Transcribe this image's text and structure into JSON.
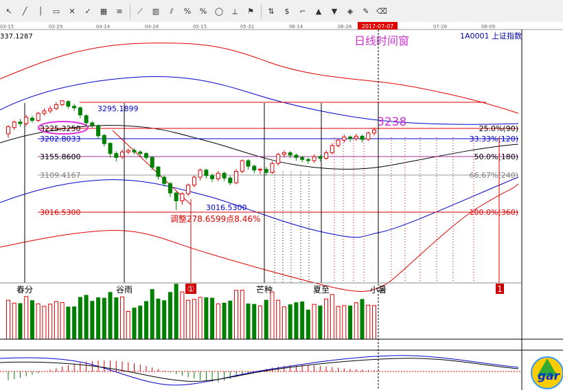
{
  "toolbar": {
    "icons": [
      "cursor-icon",
      "line-icon",
      "vertical-line-icon",
      "rect-icon",
      "cross-icon",
      "check-icon",
      "grid-icon",
      "lines-icon",
      "diag-icon",
      "bar-icon",
      "channel-icon",
      "percent-icon",
      "percent-small-icon",
      "circle-icon",
      "line-fan-icon",
      "flag-icon",
      "arrows-icon",
      "dollar-icon",
      "ruler-icon",
      "arrow-up-icon",
      "arrow-down-icon",
      "mark-icon",
      "pencil-icon",
      "eraser-icon"
    ]
  },
  "header": {
    "left_price": "337.1287",
    "window_title": "日线时间窗",
    "symbol": "1A0001 上证指数",
    "current_price": "3238"
  },
  "colors": {
    "red": "#e00000",
    "blue": "#0000cc",
    "black": "#000000",
    "green": "#008000",
    "magenta": "#cc33cc",
    "gray": "#808080"
  },
  "chart_data": {
    "type": "candlestick",
    "dates": [
      "03-15",
      "03-29",
      "04-14",
      "04-28",
      "05-15",
      "05-31",
      "06-14",
      "06-28",
      "2017-07-07",
      "07-26",
      "08-09"
    ],
    "highlighted_date": "2017-07-07",
    "price_labels": [
      {
        "label": "3295.1899",
        "color": "blue"
      },
      {
        "label": "3225.3250",
        "color": "black"
      },
      {
        "label": "3202.8033",
        "color": "blue"
      },
      {
        "label": "3155.8600",
        "color": "black"
      },
      {
        "label": "3109.4167",
        "color": "gray"
      },
      {
        "label": "3016.5300",
        "color": "red"
      },
      {
        "label": "3016.5300",
        "color": "blue"
      }
    ],
    "adjust_label": "调整278.6599点8.46%",
    "fib_levels": [
      {
        "label": "25.0%(90)",
        "color": "black"
      },
      {
        "label": "33.33%(120)",
        "color": "blue"
      },
      {
        "label": "50.0%(180)",
        "color": "black"
      },
      {
        "label": "66.67%(240)",
        "color": "gray"
      },
      {
        "label": "100.0%(360)",
        "color": "red"
      }
    ],
    "solar_terms": [
      "春分",
      "谷雨",
      "芒种",
      "夏至",
      "小暑"
    ],
    "markers": [
      "①",
      "1"
    ],
    "candles": [
      [
        3210,
        3228,
        3200,
        3232
      ],
      [
        3226,
        3240,
        3220,
        3244
      ],
      [
        3240,
        3236,
        3228,
        3248
      ],
      [
        3236,
        3252,
        3230,
        3258
      ],
      [
        3250,
        3244,
        3238,
        3256
      ],
      [
        3244,
        3262,
        3240,
        3266
      ],
      [
        3262,
        3268,
        3256,
        3275
      ],
      [
        3268,
        3274,
        3262,
        3281
      ],
      [
        3274,
        3284,
        3270,
        3290
      ],
      [
        3284,
        3294,
        3280,
        3295
      ],
      [
        3292,
        3280,
        3274,
        3295
      ],
      [
        3280,
        3276,
        3268,
        3286
      ],
      [
        3276,
        3258,
        3250,
        3280
      ],
      [
        3256,
        3238,
        3230,
        3260
      ],
      [
        3238,
        3232,
        3225,
        3242
      ],
      [
        3230,
        3205,
        3198,
        3234
      ],
      [
        3206,
        3185,
        3178,
        3210
      ],
      [
        3186,
        3160,
        3150,
        3188
      ],
      [
        3160,
        3150,
        3140,
        3166
      ],
      [
        3152,
        3164,
        3146,
        3170
      ],
      [
        3164,
        3168,
        3158,
        3172
      ],
      [
        3168,
        3164,
        3158,
        3174
      ],
      [
        3164,
        3160,
        3152,
        3168
      ],
      [
        3160,
        3150,
        3144,
        3164
      ],
      [
        3150,
        3125,
        3118,
        3154
      ],
      [
        3126,
        3102,
        3094,
        3128
      ],
      [
        3100,
        3084,
        3076,
        3104
      ],
      [
        3084,
        3060,
        3050,
        3088
      ],
      [
        3060,
        3040,
        3016,
        3064
      ],
      [
        3040,
        3058,
        3030,
        3062
      ],
      [
        3058,
        3080,
        3052,
        3084
      ],
      [
        3080,
        3100,
        3074,
        3104
      ],
      [
        3100,
        3118,
        3092,
        3122
      ],
      [
        3118,
        3104,
        3096,
        3122
      ],
      [
        3104,
        3096,
        3088,
        3110
      ],
      [
        3096,
        3110,
        3090,
        3116
      ],
      [
        3110,
        3098,
        3090,
        3114
      ],
      [
        3098,
        3086,
        3080,
        3104
      ],
      [
        3086,
        3115,
        3082,
        3120
      ],
      [
        3115,
        3142,
        3110,
        3145
      ],
      [
        3142,
        3128,
        3120,
        3146
      ],
      [
        3128,
        3118,
        3110,
        3132
      ],
      [
        3118,
        3120,
        3108,
        3124
      ],
      [
        3120,
        3112,
        3104,
        3126
      ],
      [
        3112,
        3135,
        3108,
        3140
      ],
      [
        3135,
        3158,
        3130,
        3162
      ],
      [
        3158,
        3162,
        3150,
        3168
      ],
      [
        3162,
        3156,
        3148,
        3166
      ],
      [
        3156,
        3150,
        3142,
        3160
      ],
      [
        3150,
        3145,
        3138,
        3154
      ],
      [
        3145,
        3142,
        3134,
        3150
      ],
      [
        3142,
        3152,
        3136,
        3158
      ],
      [
        3152,
        3148,
        3140,
        3156
      ],
      [
        3148,
        3162,
        3144,
        3168
      ],
      [
        3162,
        3180,
        3158,
        3186
      ],
      [
        3180,
        3194,
        3176,
        3198
      ],
      [
        3194,
        3202,
        3188,
        3208
      ],
      [
        3202,
        3198,
        3190,
        3206
      ],
      [
        3198,
        3204,
        3192,
        3210
      ],
      [
        3204,
        3196,
        3188,
        3208
      ],
      [
        3196,
        3212,
        3192,
        3216
      ],
      [
        3212,
        3220,
        3206,
        3226
      ]
    ]
  }
}
